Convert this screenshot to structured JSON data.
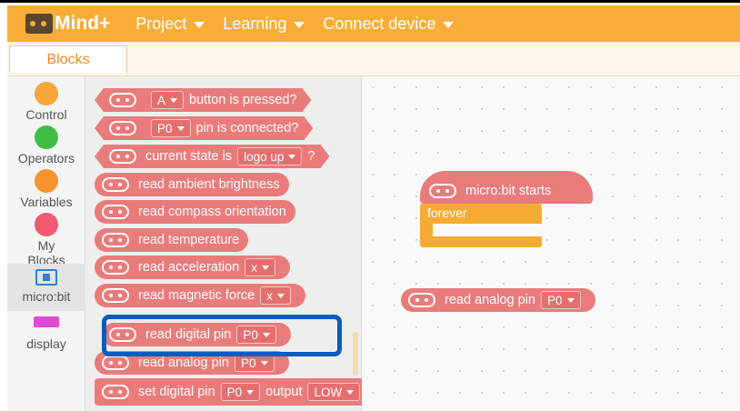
{
  "menubar": {
    "logo_text": "Mind+",
    "items": [
      {
        "label": "Project"
      },
      {
        "label": "Learning"
      },
      {
        "label": "Connect device"
      }
    ],
    "color": "#f8ad38"
  },
  "tabs": [
    {
      "label": "Blocks"
    }
  ],
  "sidebar": {
    "categories": [
      {
        "label": "Control",
        "color": "#f8a53a"
      },
      {
        "label": "Operators",
        "color": "#3fbe45"
      },
      {
        "label": "Variables",
        "color": "#f8932f"
      },
      {
        "label": "My Blocks",
        "color": "#f0596f"
      },
      {
        "label": "micro:bit",
        "icon": "chip-icon"
      },
      {
        "label": "display",
        "icon": "display-icon"
      }
    ]
  },
  "palette": {
    "block_color": "#ea7b7b",
    "blocks": [
      {
        "text_before": "",
        "dropdown": "A",
        "text_after": "button is pressed?"
      },
      {
        "text_before": "",
        "dropdown": "P0",
        "text_after": "pin is connected?"
      },
      {
        "text_before": "current state is",
        "dropdown": "logo up",
        "text_after": "?"
      },
      {
        "text": "read ambient brightness"
      },
      {
        "text": "read compass orientation"
      },
      {
        "text": "read temperature"
      },
      {
        "text": "read acceleration",
        "dropdown": "x"
      },
      {
        "text": "read magnetic force",
        "dropdown": "x"
      },
      {
        "text": "read digital pin",
        "dropdown": "P0"
      },
      {
        "text": "read analog pin",
        "dropdown": "P0"
      },
      {
        "text_before": "set digital pin",
        "dropdown": "P0",
        "text_mid": "output",
        "dropdown2": "LOW"
      }
    ]
  },
  "workspace": {
    "hat_label": "micro:bit starts",
    "forever_label": "forever",
    "loose_block": {
      "text": "read analog pin",
      "dropdown": "P0"
    },
    "highlight_color": "#0a5dbd"
  }
}
